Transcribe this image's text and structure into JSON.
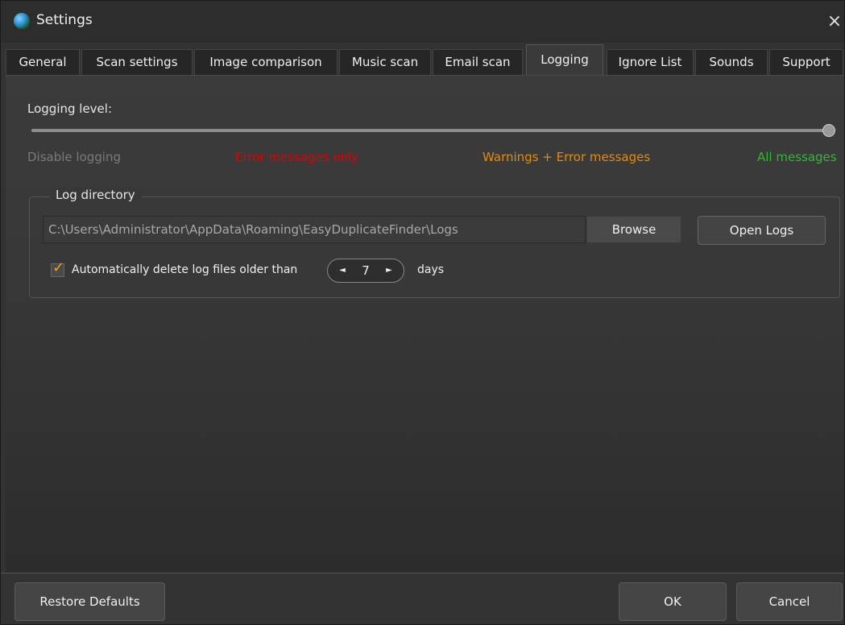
{
  "window": {
    "title": "Settings",
    "close_icon": "×"
  },
  "tabs": [
    {
      "label": "General",
      "active": false
    },
    {
      "label": "Scan settings",
      "active": false
    },
    {
      "label": "Image comparison",
      "active": false
    },
    {
      "label": "Music scan",
      "active": false
    },
    {
      "label": "Email scan",
      "active": false
    },
    {
      "label": "Logging",
      "active": true
    },
    {
      "label": "Ignore List",
      "active": false
    },
    {
      "label": "Sounds",
      "active": false
    },
    {
      "label": "Support",
      "active": false
    }
  ],
  "logging": {
    "level_label": "Logging level:",
    "level_fraction": 1.0,
    "levels": [
      {
        "label": "Disable logging",
        "color": "#7a7a7a"
      },
      {
        "label": "Error messages only",
        "color": "#e00000"
      },
      {
        "label": "Warnings + Error messages",
        "color": "#e48a0c"
      },
      {
        "label": "All messages",
        "color": "#33b833"
      }
    ]
  },
  "log_directory": {
    "title": "Log directory",
    "path": "C:\\Users\\Administrator\\AppData\\Roaming\\EasyDuplicateFinder\\Logs",
    "browse_label": "Browse",
    "open_logs_label": "Open Logs",
    "auto_delete_checked": true,
    "auto_delete_label": "Automatically delete log files older than",
    "days_value": "7",
    "days_label": "days",
    "dec_icon": "◄",
    "inc_icon": "►",
    "check_icon": "✓"
  },
  "footer": {
    "restore_label": "Restore Defaults",
    "ok_label": "OK",
    "cancel_label": "Cancel"
  }
}
